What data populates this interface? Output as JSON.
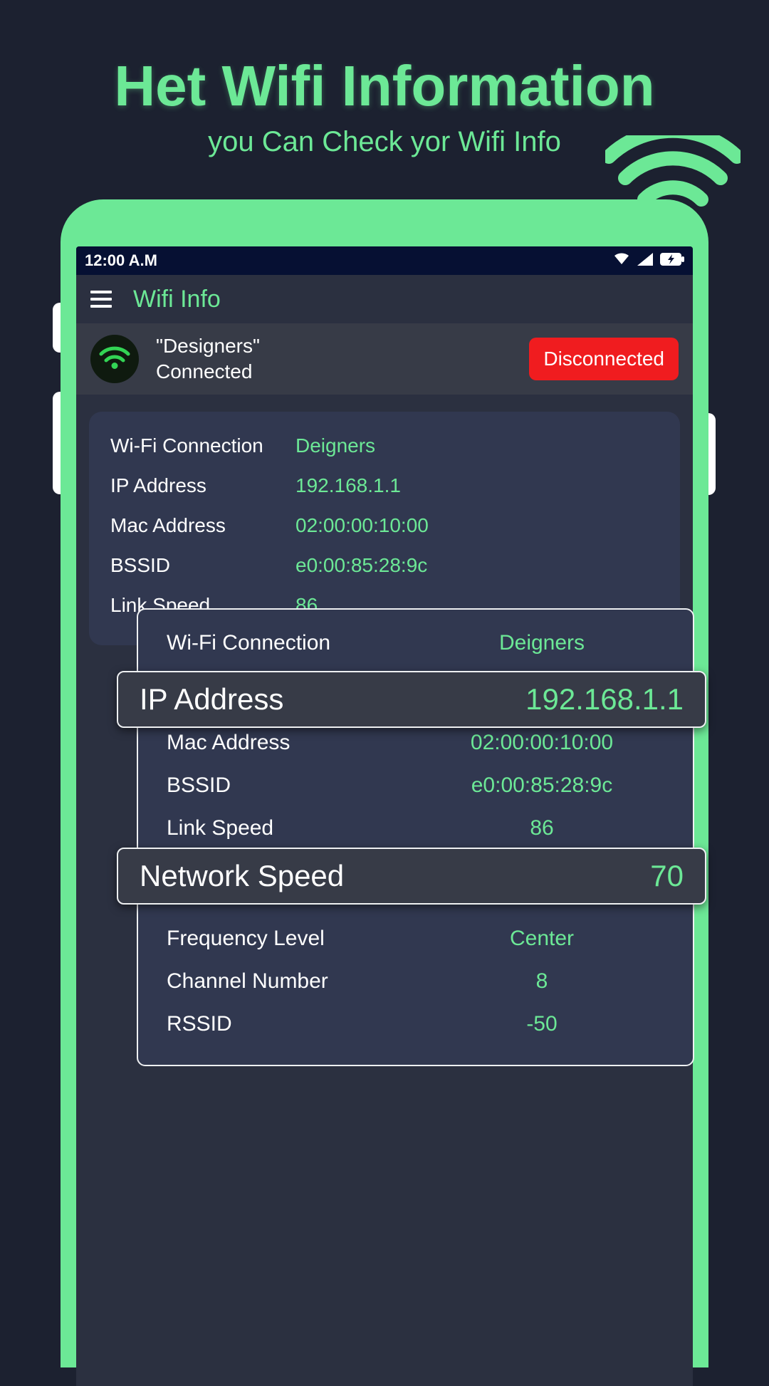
{
  "hero": {
    "title": "Het Wifi Information",
    "subtitle": "you Can Check yor Wifi Info"
  },
  "statusbar": {
    "time": "12:00 A.M"
  },
  "appbar": {
    "title": "Wifi Info"
  },
  "connection": {
    "ssid_quoted": "\"Designers\"",
    "status": "Connected",
    "disconnect_label": "Disconnected"
  },
  "panel1": {
    "rows": [
      {
        "label": "Wi-Fi Connection",
        "value": "Deigners"
      },
      {
        "label": "IP Address",
        "value": "192.168.1.1"
      },
      {
        "label": "Mac Address",
        "value": "02:00:00:10:00"
      },
      {
        "label": "BSSID",
        "value": "e0:00:85:28:9c"
      },
      {
        "label": "Link Speed",
        "value": "86"
      }
    ]
  },
  "panel2": {
    "rows": [
      {
        "label": "Wi-Fi Connection",
        "value": "Deigners"
      },
      {
        "label": "IP Address",
        "value": "192.168.1.1"
      },
      {
        "label": "Mac Address",
        "value": "02:00:00:10:00"
      },
      {
        "label": "BSSID",
        "value": "e0:00:85:28:9c"
      },
      {
        "label": "Link Speed",
        "value": "86"
      },
      {
        "label": "Network Speed",
        "value": "70"
      },
      {
        "label": "Frequency Level",
        "value": "Center"
      },
      {
        "label": "Channel Number",
        "value": "8"
      },
      {
        "label": "RSSID",
        "value": "-50"
      }
    ]
  },
  "highlight1": {
    "label": "IP Address",
    "value": "192.168.1.1"
  },
  "highlight2": {
    "label": "Network Speed",
    "value": "70"
  },
  "colors": {
    "accent": "#6ce896",
    "bg": "#1c2130",
    "panel": "#313850",
    "card": "#373b47",
    "danger": "#f01c1f"
  }
}
